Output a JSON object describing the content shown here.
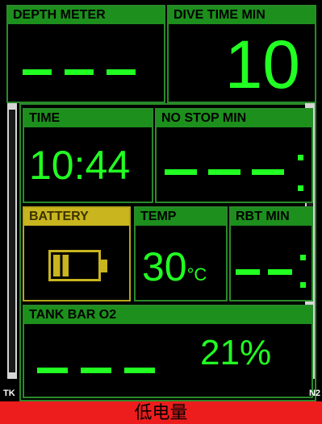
{
  "depth": {
    "header": "DEPTH    METER",
    "value": "---"
  },
  "dive_time": {
    "header": "DIVE TIME    MIN",
    "value": "10"
  },
  "time": {
    "header": "TIME",
    "value": "10:44"
  },
  "no_stop": {
    "header": "NO STOP  MIN",
    "value": "---:"
  },
  "battery": {
    "header": "BATTERY",
    "level": 0.35
  },
  "temp": {
    "header": "TEMP",
    "value": "30",
    "unit": "°C"
  },
  "rbt": {
    "header": "RBT  MIN",
    "value": "--:"
  },
  "tank": {
    "header": "TANK     BAR                O2",
    "pressure": "---",
    "o2": "21%"
  },
  "side_labels": {
    "left": "TK",
    "right": "N2"
  },
  "footer": {
    "message": "低电量"
  },
  "colors": {
    "accent": "#22ff22",
    "header_green": "#1d8f1d",
    "battery_yellow": "#c9b51e",
    "alert_red": "#ee1d1d"
  }
}
